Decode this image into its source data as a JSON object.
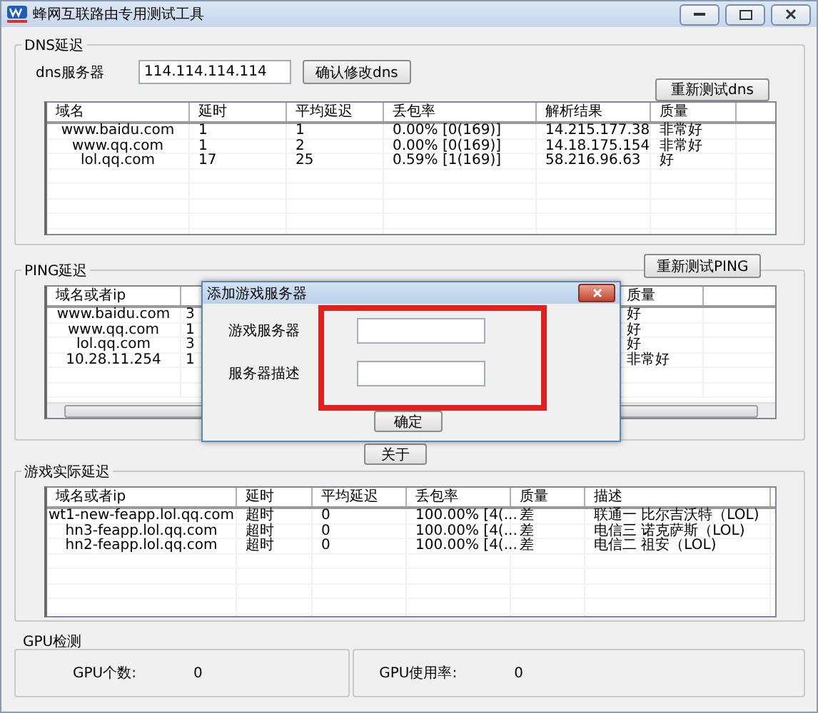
{
  "window": {
    "title": "蜂网互联路由专用测试工具"
  },
  "dns": {
    "title": "DNS延迟",
    "server_label": "dns服务器",
    "server_value": "114.114.114.114",
    "confirm_button": "确认修改dns",
    "retest_button": "重新测试dns",
    "columns": [
      "域名",
      "延时",
      "平均延迟",
      "丢包率",
      "解析结果",
      "质量"
    ],
    "rows": [
      [
        "www.baidu.com",
        "1",
        "1",
        "0.00%   [0(169)]",
        "14.215.177.38",
        "非常好"
      ],
      [
        "www.qq.com",
        "1",
        "2",
        "0.00%   [0(169)]",
        "14.18.175.154",
        "非常好"
      ],
      [
        "lol.qq.com",
        "17",
        "25",
        "0.59%   [1(169)]",
        "58.216.96.63",
        "好"
      ]
    ]
  },
  "ping": {
    "title": "PING延迟",
    "retest_button": "重新测试PING",
    "domain_header": "域名或者ip",
    "quality_header": "质量",
    "rows": [
      {
        "domain": "www.baidu.com",
        "column_2": "3",
        "quality": "好"
      },
      {
        "domain": "www.qq.com",
        "column_2": "1",
        "quality": "好"
      },
      {
        "domain": "lol.qq.com",
        "column_2": "3",
        "quality": "好"
      },
      {
        "domain": "10.28.11.254",
        "column_2": "1",
        "quality": "非常好"
      }
    ]
  },
  "dialog": {
    "title": "添加游戏服务器",
    "fields": [
      {
        "label": "游戏服务器"
      },
      {
        "label": "服务器描述"
      }
    ],
    "ok_button": "确定"
  },
  "about_button": "关于",
  "game": {
    "title": "游戏实际延迟",
    "columns": [
      "域名或者ip",
      "延时",
      "平均延迟",
      "丢包率",
      "质量",
      "描述"
    ],
    "rows": [
      [
        "wt1-new-feapp.lol.qq.com",
        "超时",
        "0",
        "100.00%   [4(...",
        "差",
        "联通一 比尔吉沃特（LOL)"
      ],
      [
        "hn3-feapp.lol.qq.com",
        "超时",
        "0",
        "100.00%   [4(...",
        "差",
        "电信三 诺克萨斯（LOL)"
      ],
      [
        "hn2-feapp.lol.qq.com",
        "超时",
        "0",
        "100.00%   [4(...",
        "差",
        "电信二 祖安（LOL)"
      ]
    ]
  },
  "gpu": {
    "title": "GPU检测",
    "count_label": "GPU个数:",
    "count_value": "0",
    "usage_label": "GPU使用率:",
    "usage_value": "0"
  }
}
